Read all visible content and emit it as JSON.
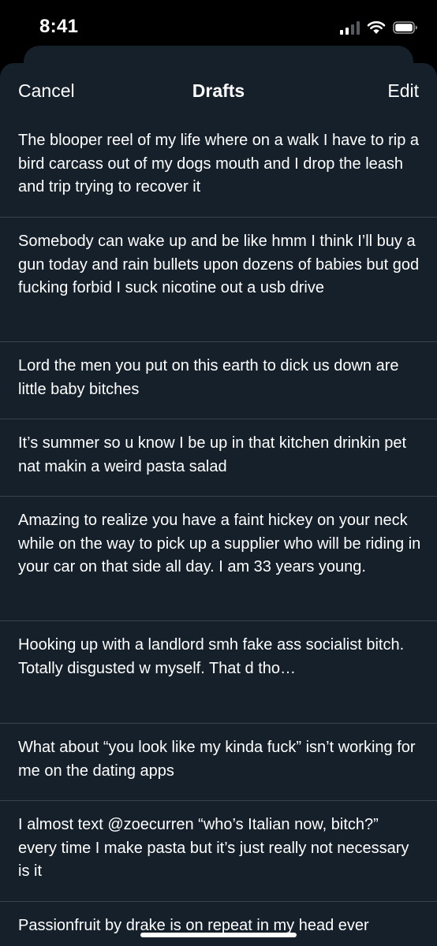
{
  "status_bar": {
    "time": "8:41",
    "icons": [
      "cellular-signal-icon",
      "wifi-icon",
      "battery-icon"
    ]
  },
  "nav": {
    "cancel_label": "Cancel",
    "title": "Drafts",
    "edit_label": "Edit"
  },
  "drafts": [
    {
      "text": "The blooper reel of my life where on a walk I have to rip a bird carcass out of my dogs mouth and I drop the leash and trip trying to recover it"
    },
    {
      "text": "Somebody can wake up and be like hmm I think I’ll buy a gun today and rain bullets upon dozens of babies but god fucking forbid I suck nicotine out a usb drive"
    },
    {
      "text": "Lord the men you put on this earth to dick us down are little baby bitches"
    },
    {
      "text": "It’s summer so u know I be up in that kitchen drinkin pet nat makin a weird pasta salad"
    },
    {
      "text": "Amazing to realize you have a faint hickey on your neck while on the way to pick up a supplier who will be riding in your car on that side all day. I am 33 years young."
    },
    {
      "text": "Hooking up with a landlord smh fake ass socialist bitch. Totally disgusted w myself. That d tho…"
    },
    {
      "text": "What about “you look like my kinda fuck” isn’t working for me on the dating apps"
    },
    {
      "text": "I almost text @zoecurren “who’s Italian now, bitch?” every time I make pasta but it’s just really not necessary is it"
    },
    {
      "text": "Passionfruit by drake is on repeat in my head ever"
    }
  ],
  "colors": {
    "background": "#000000",
    "sheet": "#15202b",
    "divider": "#38444d",
    "text": "#ffffff"
  }
}
